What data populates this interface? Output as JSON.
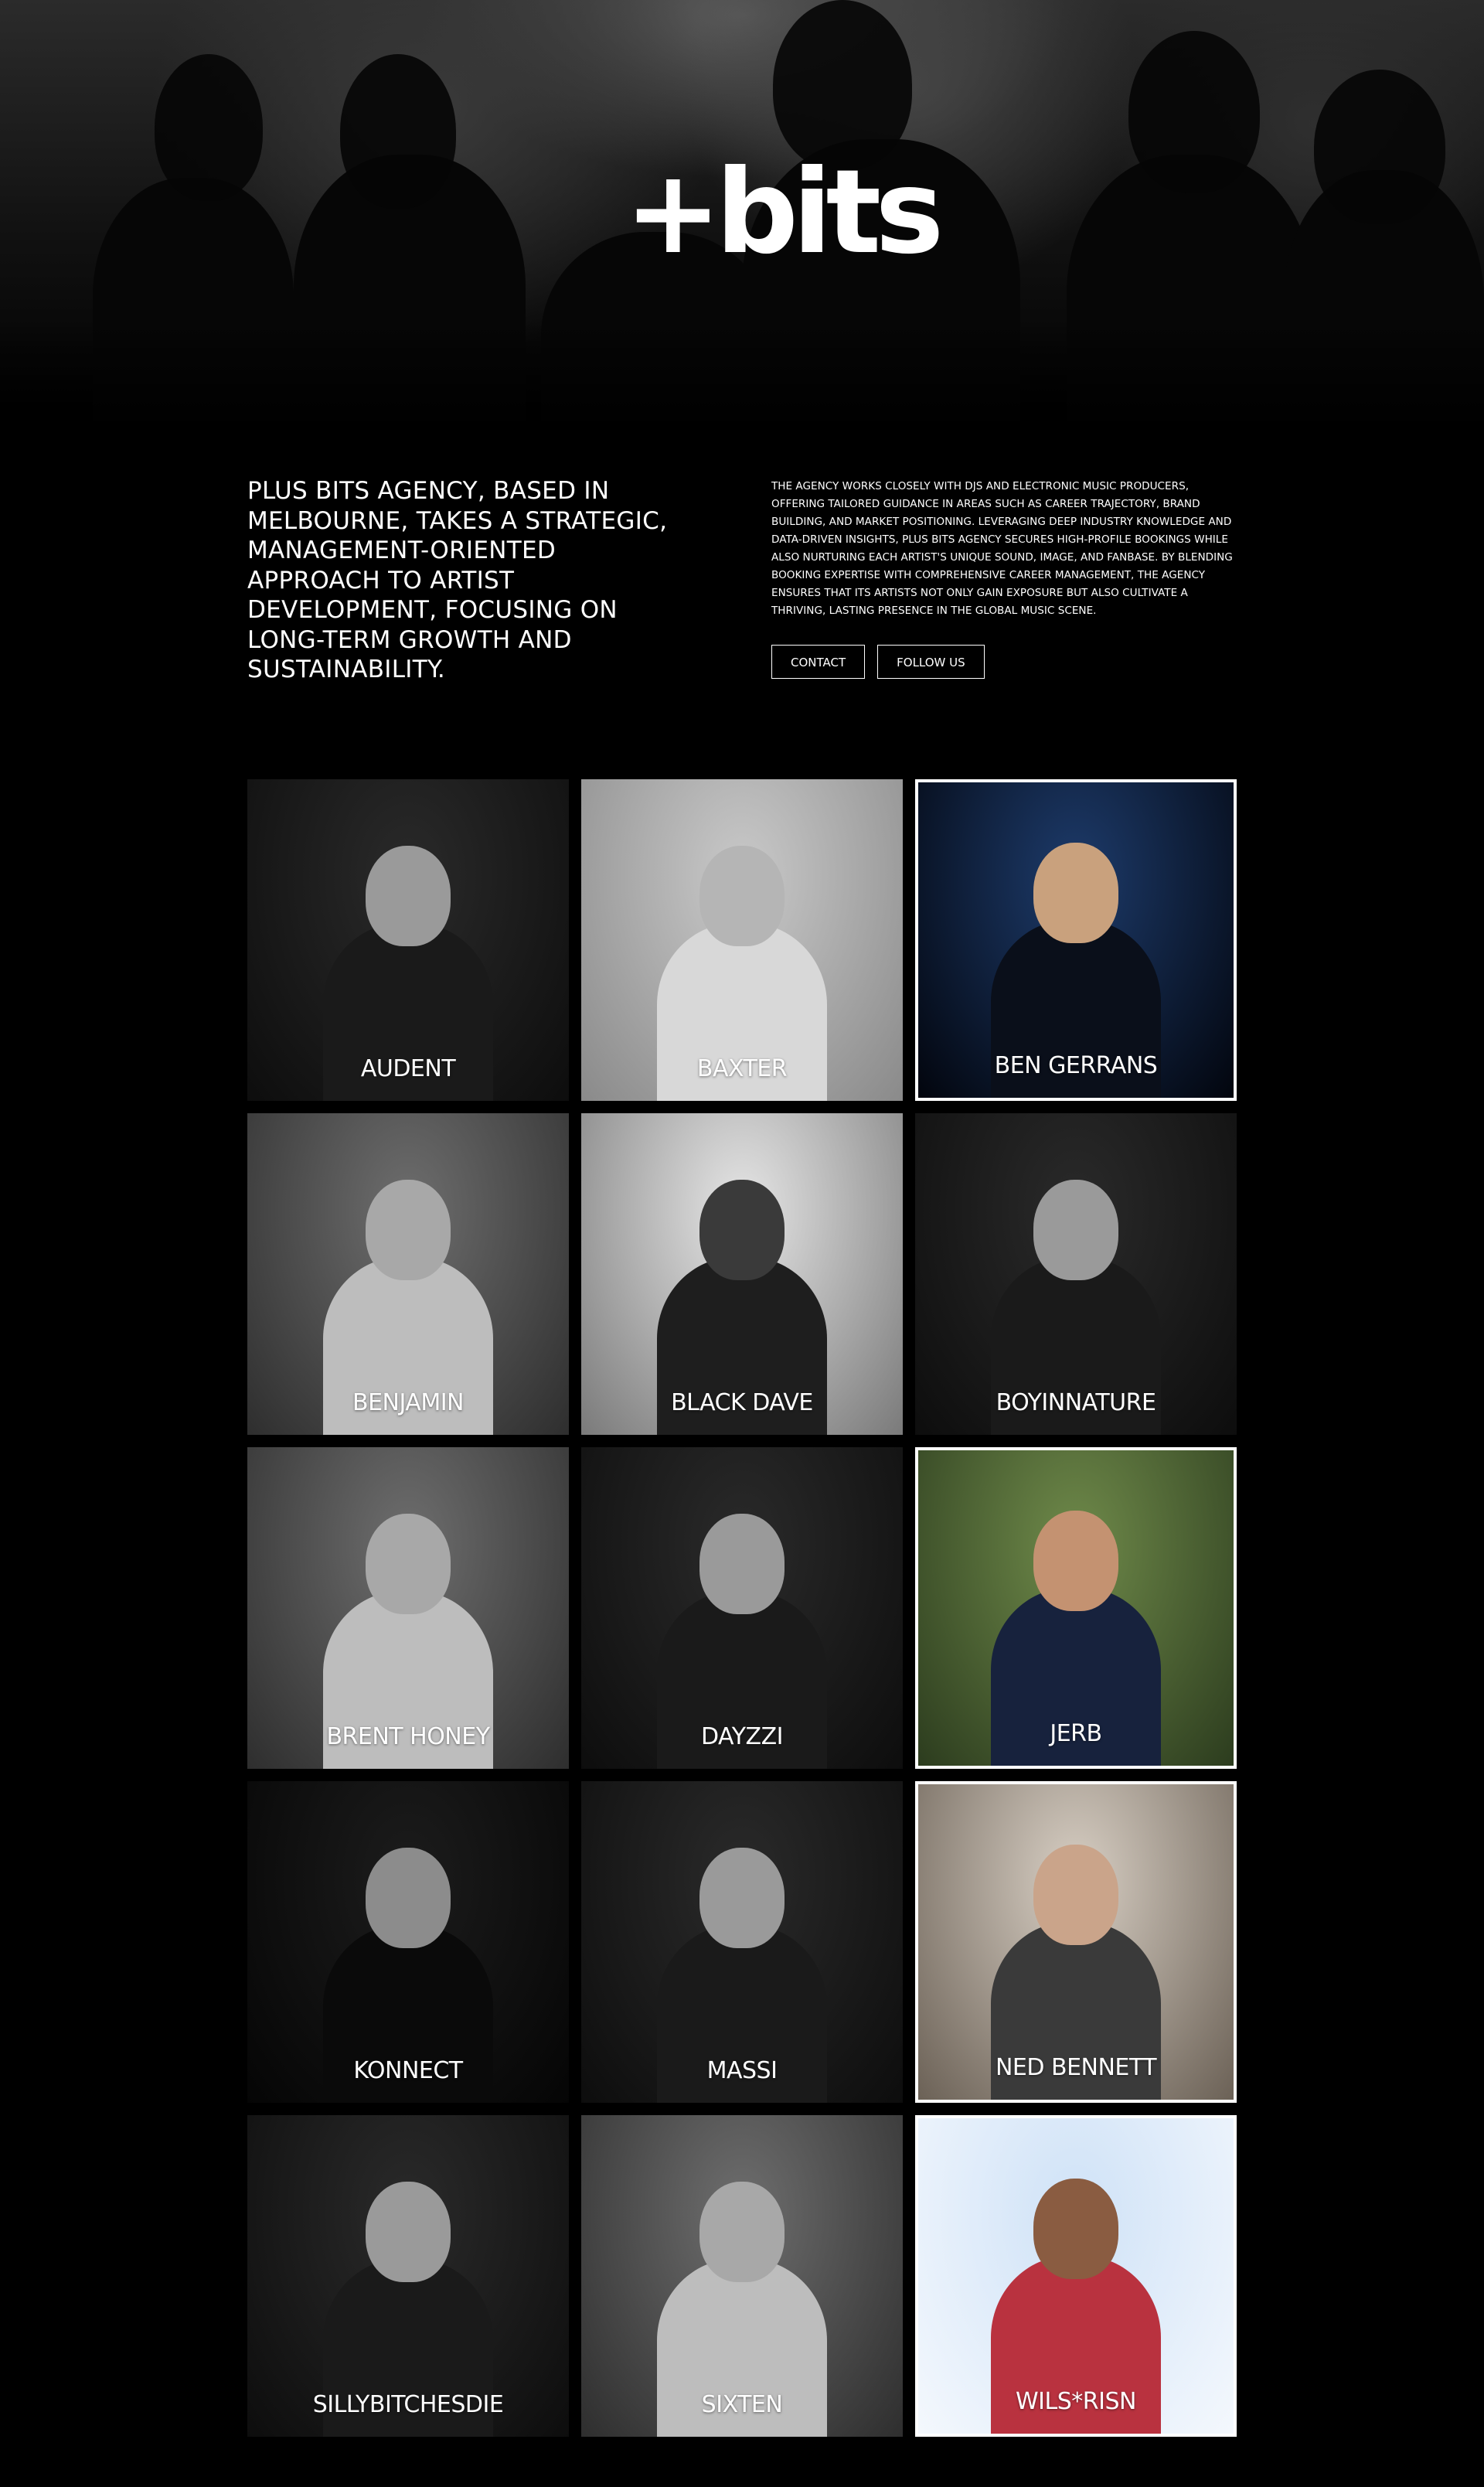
{
  "brand": {
    "logo_text": "+bits"
  },
  "intro": {
    "headline": "Plus Bits Agency, based in Melbourne, takes a strategic, management-oriented approach to artist development, focusing on long-term growth and sustainability.",
    "description": "The agency works closely with DJs and electronic music producers, offering tailored guidance in areas such as career trajectory, brand building, and market positioning. Leveraging deep industry knowledge and data-driven insights, Plus Bits Agency secures high-profile bookings while also nurturing each artist's unique sound, image, and fanbase. By blending booking expertise with comprehensive career management, the agency ensures that its artists not only gain exposure but also cultivate a thriving, lasting presence in the global music scene."
  },
  "buttons": {
    "contact": "Contact",
    "follow": "Follow Us"
  },
  "artists": [
    {
      "name": "Audent",
      "tone": "mono-dark",
      "outlined": false
    },
    {
      "name": "Baxter",
      "tone": "mono-light",
      "outlined": false
    },
    {
      "name": "Ben Gerrans",
      "tone": "color-blue",
      "outlined": true
    },
    {
      "name": "Benjamin",
      "tone": "mono-mid",
      "outlined": false
    },
    {
      "name": "Black Dave",
      "tone": "mono-bright",
      "outlined": false
    },
    {
      "name": "Boyinnature",
      "tone": "mono-dark",
      "outlined": false
    },
    {
      "name": "Brent Honey",
      "tone": "mono-mid",
      "outlined": false
    },
    {
      "name": "Dayzzi",
      "tone": "mono-dark",
      "outlined": false
    },
    {
      "name": "Jerb",
      "tone": "color-green",
      "outlined": true
    },
    {
      "name": "Konnect",
      "tone": "mono-black",
      "outlined": false
    },
    {
      "name": "Massi",
      "tone": "mono-dark",
      "outlined": false
    },
    {
      "name": "Ned Bennett",
      "tone": "color-warm",
      "outlined": true
    },
    {
      "name": "sillybitchesdie",
      "tone": "mono-dark",
      "outlined": false
    },
    {
      "name": "Sixten",
      "tone": "mono-mid",
      "outlined": false
    },
    {
      "name": "Wils*Risn",
      "tone": "color-sky",
      "outlined": true
    }
  ],
  "tones": {
    "mono-dark": {
      "bg": "#2a2a2a",
      "bg2": "#0d0d0d",
      "body": "#1a1a1a",
      "face": "#9a9a9a"
    },
    "mono-light": {
      "bg": "#c9c9c9",
      "bg2": "#8a8a8a",
      "body": "#d8d8d8",
      "face": "#b5b5b5"
    },
    "mono-mid": {
      "bg": "#6e6e6e",
      "bg2": "#2e2e2e",
      "body": "#bdbdbd",
      "face": "#a8a8a8"
    },
    "mono-bright": {
      "bg": "#e6e6e6",
      "bg2": "#7a7a7a",
      "body": "#1e1e1e",
      "face": "#3a3a3a"
    },
    "mono-black": {
      "bg": "#1c1c1c",
      "bg2": "#050505",
      "body": "#0a0a0a",
      "face": "#8c8c8c"
    },
    "color-blue": {
      "bg": "#1d3b6b",
      "bg2": "#02050d",
      "body": "#0a0f1a",
      "face": "#c9a17d"
    },
    "color-green": {
      "bg": "#6f8a4a",
      "bg2": "#2c3c1e",
      "body": "#17223d",
      "face": "#c49271"
    },
    "color-warm": {
      "bg": "#d8cfc4",
      "bg2": "#6b6156",
      "body": "#3a3a3a",
      "face": "#caa48a"
    },
    "color-sky": {
      "bg": "#cfe2f7",
      "bg2": "#f4f8fd",
      "body": "#b9323f",
      "face": "#8a5c41"
    }
  }
}
